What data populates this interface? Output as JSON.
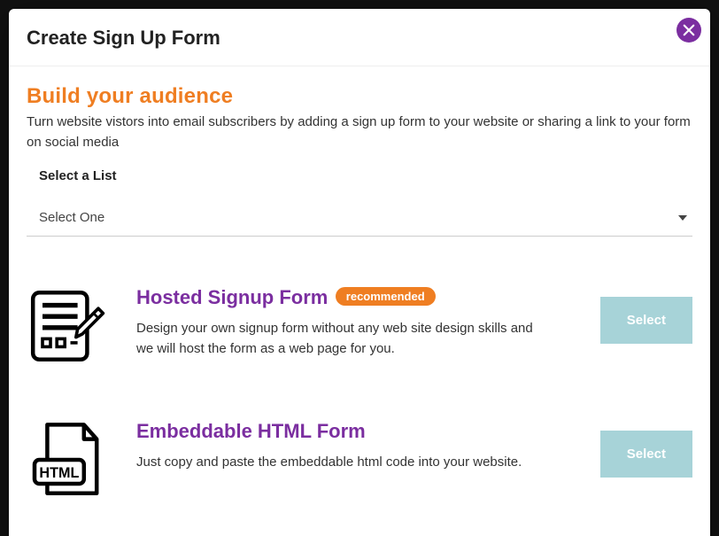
{
  "modal": {
    "title": "Create Sign Up Form",
    "close_icon": "close"
  },
  "header": {
    "title": "Build your audience",
    "description": "Turn website vistors into email subscribers by adding a sign up form to your website or sharing a link to your form on social media"
  },
  "list_field": {
    "label": "Select a List",
    "placeholder": "Select One"
  },
  "options": [
    {
      "title": "Hosted Signup Form",
      "badge": "recommended",
      "description": "Design your own signup form without any web site design skills and we will host the form as a web page for you.",
      "button": "Select",
      "icon": "form-pencil"
    },
    {
      "title": "Embeddable HTML Form",
      "badge": null,
      "description": "Just copy and paste the embeddable html code into your website.",
      "button": "Select",
      "icon": "html-file"
    }
  ],
  "colors": {
    "accent_orange": "#ef7e22",
    "accent_purple": "#7b2ea0",
    "button_teal": "#a7d3d8"
  }
}
